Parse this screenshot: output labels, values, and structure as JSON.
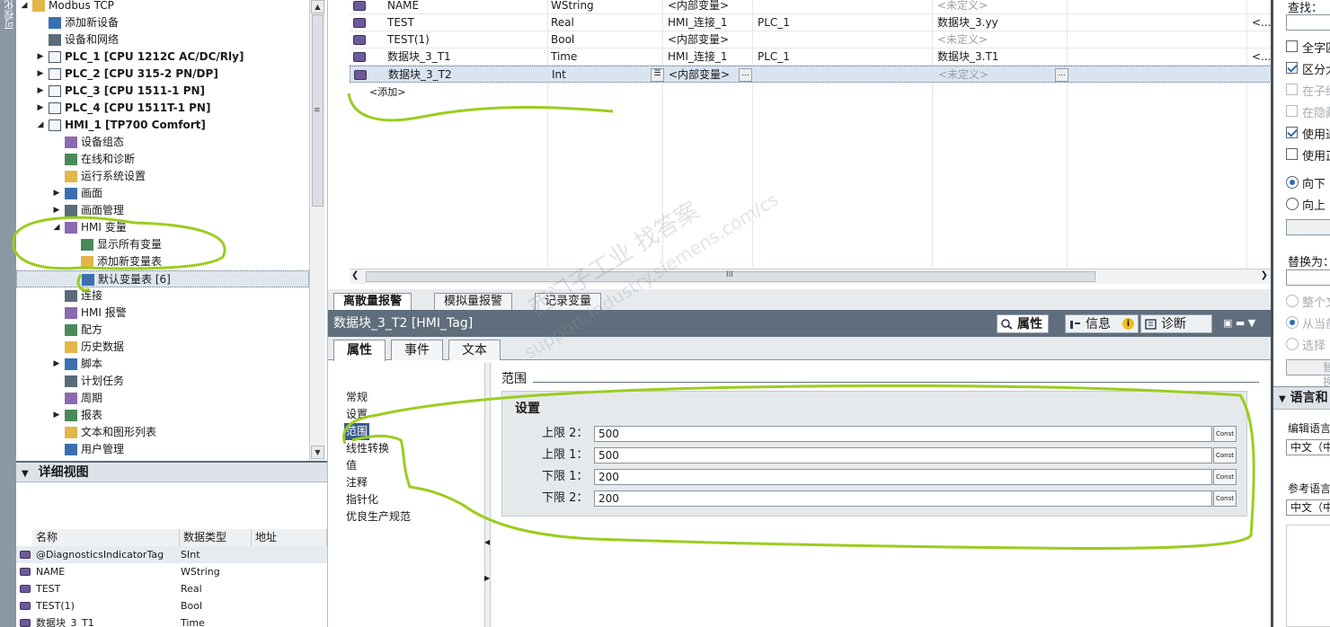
{
  "left_strip": {
    "label": "可视化"
  },
  "tree": {
    "items": [
      {
        "label": "Modbus TCP",
        "level": 0,
        "expand": "open",
        "bold": false
      },
      {
        "label": "添加新设备",
        "level": 1,
        "expand": "none",
        "bold": false
      },
      {
        "label": "设备和网络",
        "level": 1,
        "expand": "none",
        "bold": false
      },
      {
        "label": "PLC_1 [CPU 1212C AC/DC/Rly]",
        "level": 1,
        "expand": "closed",
        "bold": true
      },
      {
        "label": "PLC_2 [CPU 315-2 PN/DP]",
        "level": 1,
        "expand": "closed",
        "bold": true
      },
      {
        "label": "PLC_3 [CPU 1511-1 PN]",
        "level": 1,
        "expand": "closed",
        "bold": true
      },
      {
        "label": "PLC_4 [CPU 1511T-1 PN]",
        "level": 1,
        "expand": "closed",
        "bold": true
      },
      {
        "label": "HMI_1 [TP700 Comfort]",
        "level": 1,
        "expand": "open",
        "bold": true
      },
      {
        "label": "设备组态",
        "level": 2,
        "expand": "none",
        "bold": false
      },
      {
        "label": "在线和诊断",
        "level": 2,
        "expand": "none",
        "bold": false
      },
      {
        "label": "运行系统设置",
        "level": 2,
        "expand": "none",
        "bold": false
      },
      {
        "label": "画面",
        "level": 2,
        "expand": "closed",
        "bold": false
      },
      {
        "label": "画面管理",
        "level": 2,
        "expand": "closed",
        "bold": false
      },
      {
        "label": "HMI 变量",
        "level": 2,
        "expand": "open",
        "bold": false
      },
      {
        "label": "显示所有变量",
        "level": 3,
        "expand": "none",
        "bold": false
      },
      {
        "label": "添加新变量表",
        "level": 3,
        "expand": "none",
        "bold": false
      },
      {
        "label": "默认变量表 [6]",
        "level": 3,
        "expand": "none",
        "bold": false,
        "selected": true
      },
      {
        "label": "连接",
        "level": 2,
        "expand": "none",
        "bold": false
      },
      {
        "label": "HMI 报警",
        "level": 2,
        "expand": "none",
        "bold": false
      },
      {
        "label": "配方",
        "level": 2,
        "expand": "none",
        "bold": false
      },
      {
        "label": "历史数据",
        "level": 2,
        "expand": "none",
        "bold": false
      },
      {
        "label": "脚本",
        "level": 2,
        "expand": "closed",
        "bold": false
      },
      {
        "label": "计划任务",
        "level": 2,
        "expand": "none",
        "bold": false
      },
      {
        "label": "周期",
        "level": 2,
        "expand": "none",
        "bold": false
      },
      {
        "label": "报表",
        "level": 2,
        "expand": "closed",
        "bold": false
      },
      {
        "label": "文本和图形列表",
        "level": 2,
        "expand": "none",
        "bold": false
      },
      {
        "label": "用户管理",
        "level": 2,
        "expand": "none",
        "bold": false
      }
    ]
  },
  "details": {
    "title": "详细视图",
    "columns": [
      "名称",
      "数据类型",
      "地址"
    ],
    "rows": [
      {
        "name": "@DiagnosticsIndicatorTag",
        "type": "SInt",
        "addr": ""
      },
      {
        "name": "NAME",
        "type": "WString",
        "addr": ""
      },
      {
        "name": "TEST",
        "type": "Real",
        "addr": ""
      },
      {
        "name": "TEST(1)",
        "type": "Bool",
        "addr": ""
      },
      {
        "name": "数据块_3_T1",
        "type": "Time",
        "addr": ""
      }
    ]
  },
  "tag_table": {
    "rows": [
      {
        "name": "NAME",
        "type": "WString",
        "conn": "<内部变量>",
        "plc": "",
        "plc_tag": "<未定义>",
        "plc_tag_muted": true,
        "more": ""
      },
      {
        "name": "TEST",
        "type": "Real",
        "conn": "HMI_连接_1",
        "plc": "PLC_1",
        "plc_tag": "数据块_3.yy",
        "plc_tag_muted": false,
        "more": "<..."
      },
      {
        "name": "TEST(1)",
        "type": "Bool",
        "conn": "<内部变量>",
        "plc": "",
        "plc_tag": "<未定义>",
        "plc_tag_muted": true,
        "more": ""
      },
      {
        "name": "数据块_3_T1",
        "type": "Time",
        "conn": "HMI_连接_1",
        "plc": "PLC_1",
        "plc_tag": "数据块_3.T1",
        "plc_tag_muted": false,
        "more": "<..."
      },
      {
        "name": "数据块_3_T2",
        "type": "Int",
        "conn": "<内部变量>",
        "plc": "",
        "plc_tag": "<未定义>",
        "plc_tag_muted": true,
        "more": "",
        "selected": true
      }
    ],
    "add_label": "<添加>",
    "scroll_grip": "III"
  },
  "bottom_tabs": [
    "离散量报警",
    "模拟量报警",
    "记录变量"
  ],
  "inspector": {
    "title": "数据块_3_T2 [HMI_Tag]",
    "top_tabs": [
      "属性",
      "信息",
      "诊断"
    ],
    "sub_tabs": [
      "属性",
      "事件",
      "文本"
    ],
    "nav": [
      "常规",
      "设置",
      "范围",
      "线性转换",
      "值",
      "注释",
      "指针化",
      "优良生产规范"
    ],
    "nav_selected_index": 2,
    "range_header": "范围",
    "settings_label": "设置",
    "limits": [
      {
        "label": "上限 2：",
        "value": "500",
        "mode": "Const"
      },
      {
        "label": "上限 1：",
        "value": "500",
        "mode": "Const"
      },
      {
        "label": "下限 1：",
        "value": "200",
        "mode": "Const"
      },
      {
        "label": "下限 2：",
        "value": "200",
        "mode": "Const"
      }
    ]
  },
  "right_panel": {
    "find_label": "查找：",
    "checkboxes": [
      {
        "label": "全字匹",
        "checked": false,
        "disabled": false
      },
      {
        "label": "区分大",
        "checked": true,
        "disabled": false
      },
      {
        "label": "在子结",
        "checked": false,
        "disabled": true
      },
      {
        "label": "在隐藏",
        "checked": false,
        "disabled": true
      },
      {
        "label": "使用通",
        "checked": true,
        "disabled": false
      },
      {
        "label": "使用正",
        "checked": false,
        "disabled": false
      }
    ],
    "direction": [
      {
        "label": "向下",
        "selected": true
      },
      {
        "label": "向上",
        "selected": false
      }
    ],
    "replace_label": "替换为：",
    "replace_scope": [
      {
        "label": "整个文",
        "selected": false
      },
      {
        "label": "从当前",
        "selected": true
      },
      {
        "label": "选择",
        "selected": false
      }
    ],
    "replace_button": "替换",
    "lang_section": "语言和",
    "edit_lang_label": "编辑语言",
    "edit_lang_value": "中文（中",
    "ref_lang_label": "参考语言",
    "ref_lang_value": "中文（中"
  },
  "watermark": {
    "line1": "西门子工业  找答案",
    "line2": "support.industry.siemens.com/cs"
  },
  "colors": {
    "title_bar": "#5e6e7c",
    "annotation": "#9acd1e",
    "selection": "#3b5c8c"
  }
}
